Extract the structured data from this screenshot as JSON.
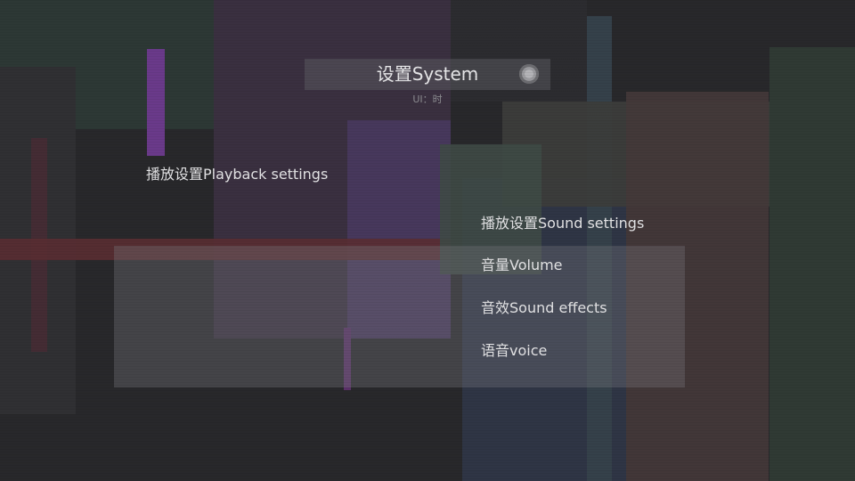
{
  "header": {
    "title": "设置System",
    "subtitle": "UI：时",
    "icon": "settings-circle-icon"
  },
  "left_menu": {
    "items": [
      {
        "label": "播放设置Playback settings"
      }
    ]
  },
  "right_menu": {
    "items": [
      {
        "label": "播放设置Sound settings"
      },
      {
        "label": "音量Volume"
      },
      {
        "label": "音效Sound effects"
      },
      {
        "label": "语音voice"
      }
    ]
  },
  "colors": {
    "background": "#28282b",
    "text": "#e4e4e6",
    "subtitle": "#8e8e92"
  }
}
